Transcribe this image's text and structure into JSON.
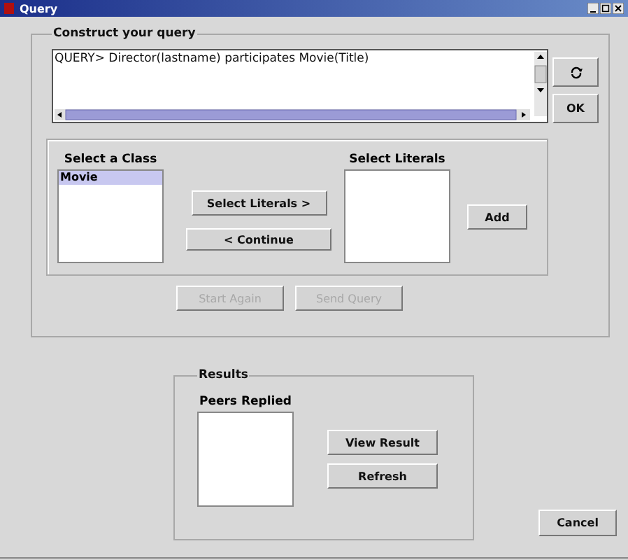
{
  "window": {
    "title": "Query"
  },
  "query_group": {
    "title": "Construct your query",
    "query_text": "QUERY> Director(lastname) participates Movie(Title)",
    "ok_button": "OK"
  },
  "class_list": {
    "label": "Select a Class",
    "items": [
      {
        "label": "Movie",
        "selected": true
      }
    ]
  },
  "select_literals_button": "Select Literals >",
  "continue_button": "< Continue",
  "literals_list": {
    "label": "Select Literals"
  },
  "add_button": "Add",
  "actions": [
    {
      "label": "Start Again",
      "disabled": true
    },
    {
      "label": "Send Query",
      "disabled": true
    }
  ],
  "results": {
    "title": "Results",
    "peers_label": "Peers Replied",
    "buttons": [
      "View Result",
      "Refresh"
    ]
  },
  "cancel_button": "Cancel"
}
